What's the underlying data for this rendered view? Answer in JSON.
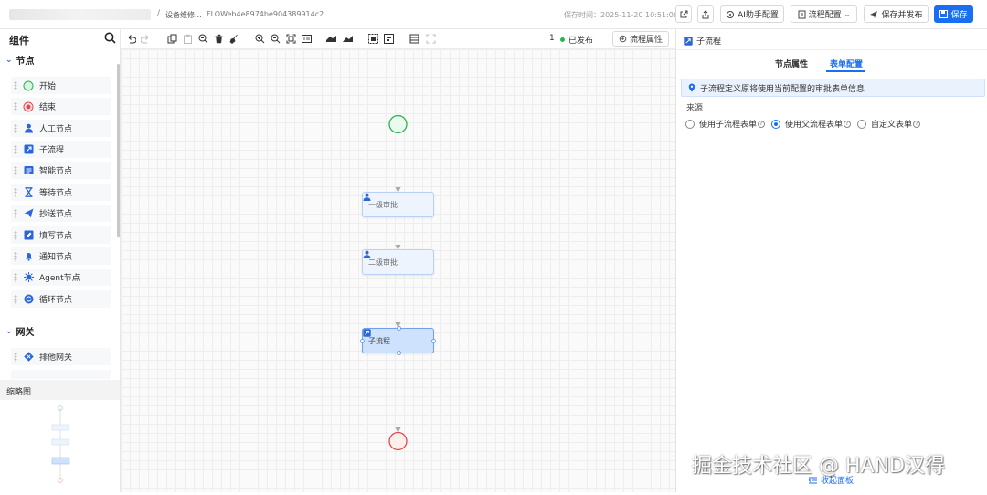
{
  "header": {
    "breadcrumb_sep": "/",
    "process_name": "设备维修...",
    "process_code": "FLOWeb4e8974be904389914c2...",
    "save_time": "保存时间：2025-11-20 10:51:06",
    "ai_button": "AI助手配置",
    "config_button": "流程配置",
    "save_publish_button": "保存并发布",
    "save_button": "保存"
  },
  "left": {
    "title": "组件",
    "groups": [
      {
        "label": "节点",
        "items": [
          {
            "label": "开始",
            "icon": "start-circle-icon",
            "color": "#2db34a"
          },
          {
            "label": "结束",
            "icon": "end-circle-icon",
            "color": "#e5484d"
          },
          {
            "label": "人工节点",
            "icon": "user-icon",
            "color": "#2a66d9"
          },
          {
            "label": "子流程",
            "icon": "subprocess-icon",
            "color": "#2a66d9"
          },
          {
            "label": "智能节点",
            "icon": "smart-icon",
            "color": "#2a66d9"
          },
          {
            "label": "等待节点",
            "icon": "hourglass-icon",
            "color": "#2a66d9"
          },
          {
            "label": "抄送节点",
            "icon": "send-icon",
            "color": "#2a66d9"
          },
          {
            "label": "填写节点",
            "icon": "edit-icon",
            "color": "#2a66d9"
          },
          {
            "label": "通知节点",
            "icon": "bell-icon",
            "color": "#2a66d9"
          },
          {
            "label": "Agent节点",
            "icon": "agent-icon",
            "color": "#2a66d9"
          },
          {
            "label": "循环节点",
            "icon": "loop-icon",
            "color": "#2a66d9"
          }
        ]
      },
      {
        "label": "网关",
        "items": [
          {
            "label": "排他网关",
            "icon": "gateway-icon",
            "color": "#2a66d9"
          }
        ]
      }
    ],
    "minimap_title": "缩略图"
  },
  "toolbar": {
    "version": "1",
    "status": "已发布",
    "process_attr_button": "流程属性"
  },
  "flow": {
    "nodes": [
      {
        "label": "一级审批",
        "icon": "user-icon"
      },
      {
        "label": "二级审批",
        "icon": "user-icon"
      },
      {
        "label": "子流程",
        "icon": "subprocess-icon",
        "selected": true
      }
    ],
    "colors": {
      "start": "#2db34a",
      "end": "#e5484d",
      "edge": "#a9a9a9"
    }
  },
  "right": {
    "title": "子流程",
    "tabs": [
      "节点属性",
      "表单配置"
    ],
    "active_tab": "表单配置",
    "info": "子流程定义原将使用当前配置的审批表单信息",
    "source_label": "来源",
    "options": [
      "使用子流程表单",
      "使用父流程表单",
      "自定义表单"
    ],
    "selected_option": "使用父流程表单",
    "collapse_link": "收起面板"
  },
  "watermark": "掘金技术社区 @ HAND汉得",
  "accent_color": "#1a6ef0"
}
